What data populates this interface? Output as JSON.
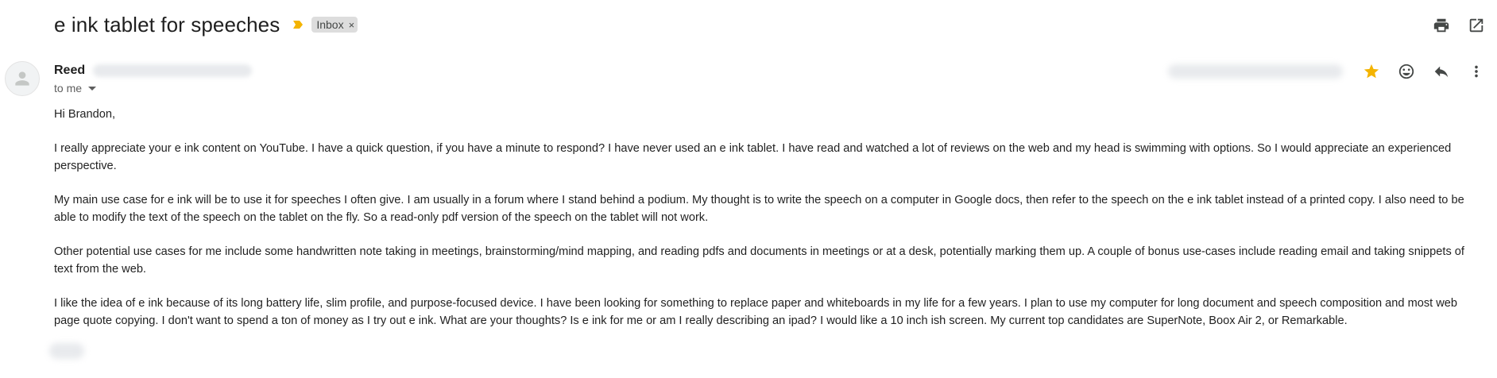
{
  "subject": "e ink tablet for speeches",
  "labels": [
    {
      "name": "Inbox",
      "remove_symbol": "×"
    }
  ],
  "top_actions": [
    {
      "icon": "print-icon"
    },
    {
      "icon": "open-in-new-window-icon"
    }
  ],
  "sender": {
    "name": "Reed"
  },
  "recipient": {
    "text": "to me"
  },
  "message_actions": [
    {
      "icon": "star-icon"
    },
    {
      "icon": "emoji-reaction-icon"
    },
    {
      "icon": "reply-icon"
    },
    {
      "icon": "more-vert-icon"
    }
  ],
  "colors": {
    "star": "#f4b400",
    "importance": "#f4b400",
    "label_bg": "#dddddd"
  },
  "body": {
    "paragraphs": [
      "Hi Brandon,",
      "I really appreciate your e ink content on YouTube. I have a quick question, if you have a minute to respond? I have never used an e ink tablet. I have read and watched a lot of reviews on the web and my head is swimming with options. So I would appreciate an experienced perspective.",
      "My main use case for e ink will be to use it for speeches I often give. I am usually in a forum where I stand behind a podium. My thought is to write the speech on a computer in Google docs, then refer to the speech on the e ink tablet instead of a printed copy. I also need to be able to modify the text of the speech on the tablet on the fly. So a read-only pdf version of the speech on the tablet will not work.",
      "Other potential use cases for me include some handwritten note taking in meetings, brainstorming/mind mapping, and reading pdfs and documents in meetings or at a desk, potentially marking them up. A couple of bonus use-cases include reading email and taking snippets of text from the web.",
      "I like the idea of e ink because of its long battery life, slim profile, and purpose-focused device. I have been looking for something to replace paper and whiteboards in my life for a few years. I plan to use my computer for long document and speech composition and most web page quote copying. I don't want to spend a ton of money as I try out e ink. What are your thoughts? Is e ink for me or am I really describing an ipad? I would like a 10 inch ish screen. My current top candidates are SuperNote, Boox Air 2, or Remarkable."
    ]
  }
}
